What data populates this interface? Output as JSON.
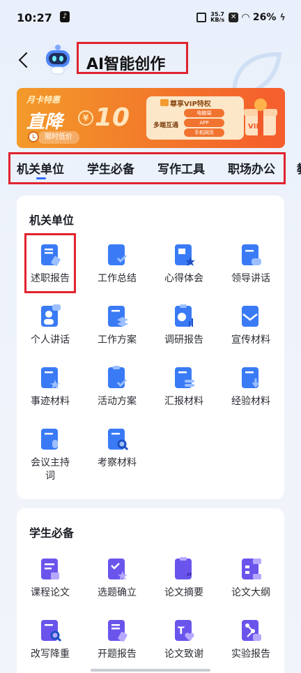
{
  "status_bar": {
    "time": "10:27",
    "net_speed": "35.7 KB/s",
    "battery": "26%"
  },
  "header": {
    "title": "AI智能创作",
    "back_icon": "chevron-left-icon",
    "mascot_icon": "robot-mascot-icon"
  },
  "banner": {
    "tag": "月卡特惠",
    "headline": "直降",
    "currency": "¥",
    "amount": "10",
    "limited": "限时低价",
    "vip_title": "尊享VIP特权",
    "multi_device": "多端互通",
    "platforms": [
      "电脑端",
      "APP",
      "手机网页"
    ],
    "vip_badge": "VIP"
  },
  "tabs": [
    {
      "label": "机关单位",
      "active": true
    },
    {
      "label": "学生必备",
      "active": false
    },
    {
      "label": "写作工具",
      "active": false
    },
    {
      "label": "职场办公",
      "active": false
    }
  ],
  "tab_overflow": "教",
  "sections": [
    {
      "title": "机关单位",
      "items": [
        {
          "label": "述职报告",
          "icon": "doc-pen-icon"
        },
        {
          "label": "工作总结",
          "icon": "folder-check-icon"
        },
        {
          "label": "心得体会",
          "icon": "doc-star-icon"
        },
        {
          "label": "领导讲话",
          "icon": "doc-chat-icon"
        },
        {
          "label": "个人讲话",
          "icon": "person-chat-icon"
        },
        {
          "label": "工作方案",
          "icon": "folder-layers-icon"
        },
        {
          "label": "调研报告",
          "icon": "clipboard-chart-icon"
        },
        {
          "label": "宣传材料",
          "icon": "envelope-icon"
        },
        {
          "label": "事迹材料",
          "icon": "folder-star-icon"
        },
        {
          "label": "活动方案",
          "icon": "clipboard-check-icon"
        },
        {
          "label": "汇报材料",
          "icon": "folder-stack-icon"
        },
        {
          "label": "经验材料",
          "icon": "folder-download-icon"
        },
        {
          "label": "会议主持词",
          "icon": "doc-mic-icon"
        },
        {
          "label": "考察材料",
          "icon": "doc-search-icon"
        }
      ]
    },
    {
      "title": "学生必备",
      "items": [
        {
          "label": "课程论文",
          "icon": "doc-lines-icon"
        },
        {
          "label": "选题确立",
          "icon": "doc-check-star-icon"
        },
        {
          "label": "论文摘要",
          "icon": "clipboard-quote-icon"
        },
        {
          "label": "论文大纲",
          "icon": "outline-tree-icon"
        },
        {
          "label": "改写降重",
          "icon": "doc-search-icon"
        },
        {
          "label": "开题报告",
          "icon": "doc-pen-icon"
        },
        {
          "label": "论文致谢",
          "icon": "text-heart-icon"
        },
        {
          "label": "实验报告",
          "icon": "flask-icon"
        }
      ]
    }
  ],
  "colors": {
    "blue_icon": "#3a7bf5",
    "purple_icon": "#6a55ec",
    "highlight": "#e0232e",
    "tab_indicator": "#2f6bff"
  }
}
